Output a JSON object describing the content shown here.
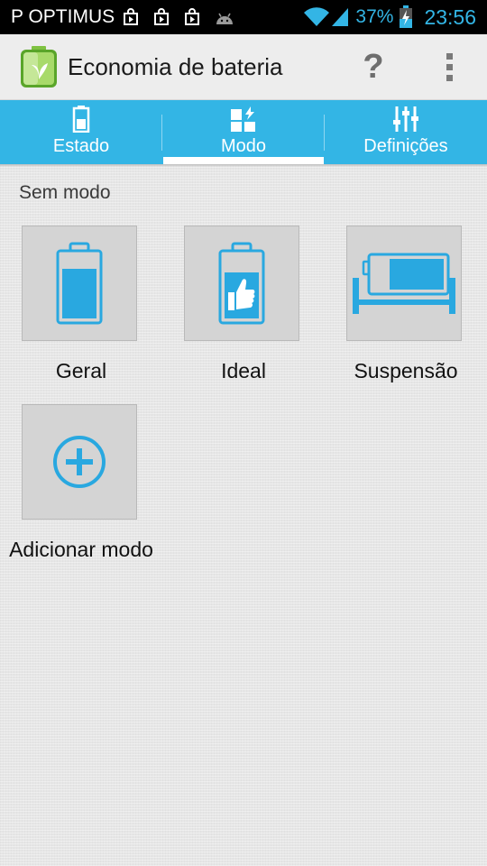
{
  "status_bar": {
    "carrier": "P OPTIMUS",
    "battery_percent": "37%",
    "time": "23:56",
    "notification_icons": [
      "play-store-icon",
      "play-store-icon",
      "play-store-icon",
      "android-icon"
    ]
  },
  "action_bar": {
    "title": "Economia de bateria",
    "help_label": "?"
  },
  "tabs": [
    {
      "label": "Estado",
      "icon": "battery-icon"
    },
    {
      "label": "Modo",
      "icon": "mode-grid-icon",
      "selected": true
    },
    {
      "label": "Definições",
      "icon": "sliders-icon"
    }
  ],
  "content": {
    "section_title": "Sem modo",
    "modes": [
      {
        "label": "Geral",
        "icon": "battery-full-icon"
      },
      {
        "label": "Ideal",
        "icon": "battery-thumbs-up-icon"
      },
      {
        "label": "Suspensão",
        "icon": "battery-bed-icon"
      }
    ],
    "add_mode": {
      "label": "Adicionar modo",
      "icon": "plus-circle-icon"
    }
  },
  "colors": {
    "accent": "#33b5e5",
    "icon_blue": "#29a8e0",
    "tile_bg": "#d4d4d4"
  }
}
